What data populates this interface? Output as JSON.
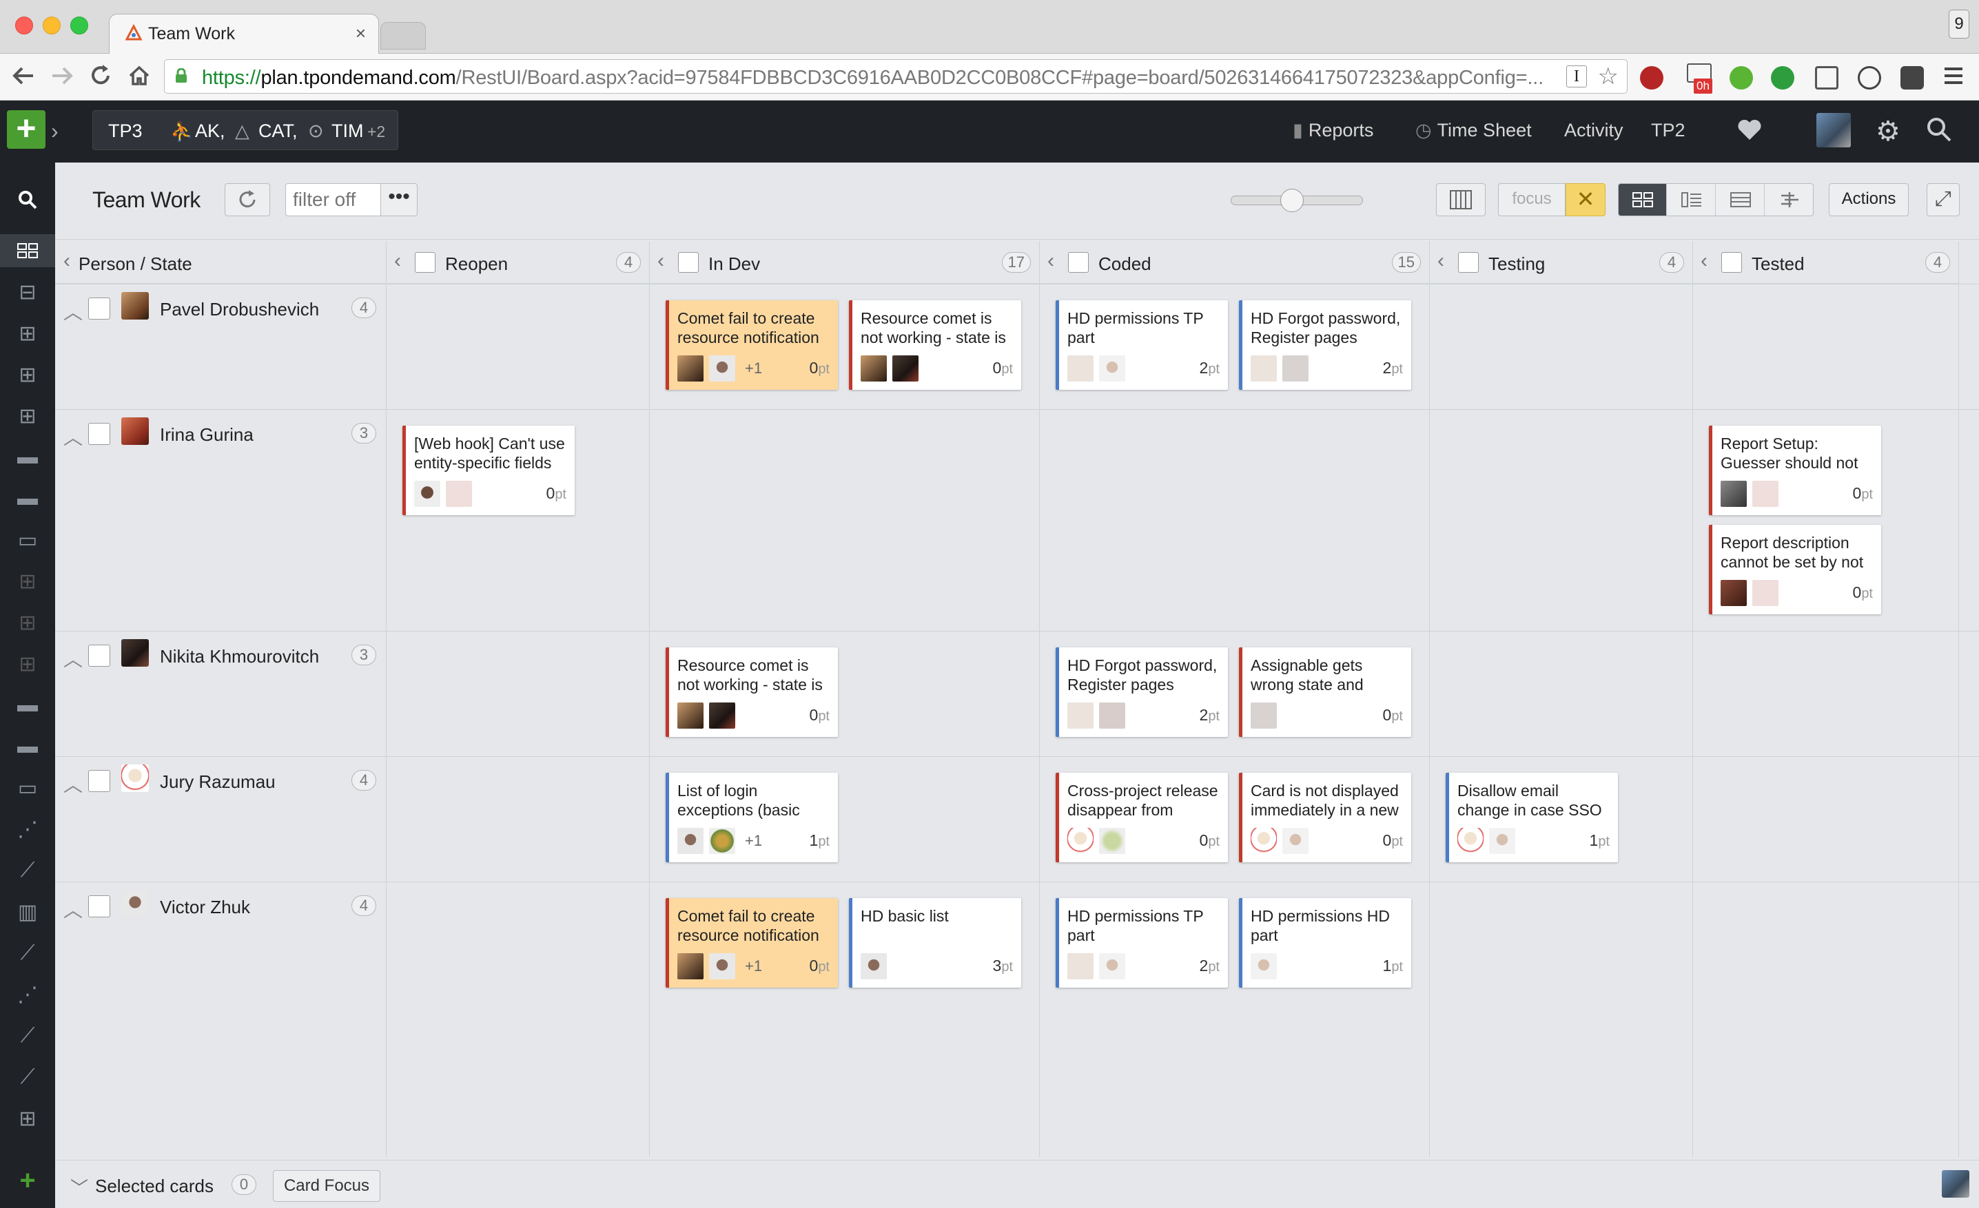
{
  "browser": {
    "tab_title": "Team Work",
    "tab_close": "×",
    "profile_badge": "9",
    "url_scheme": "https://",
    "url_domain": "plan.tpondemand.com",
    "url_rest": "/RestUI/Board.aspx?acid=97584FDBBCD3C6916AAB0D2CC0B08CCF#page=board/5026314664175072323&appConfig=...",
    "ext_badge": "0h"
  },
  "app": {
    "context": {
      "project": "TP3",
      "team1": "AK,",
      "team2": "CAT,",
      "team3": "TIM",
      "more": "+2"
    },
    "nav": {
      "reports": "Reports",
      "timesheet": "Time Sheet",
      "activity": "Activity",
      "tp2": "TP2"
    }
  },
  "board": {
    "title": "Team Work",
    "filter_placeholder": "filter off",
    "more_label": "•••",
    "focus_label": "focus",
    "actions_label": "Actions",
    "corner_label": "Person / State",
    "columns": [
      {
        "label": "Reopen",
        "count": "4"
      },
      {
        "label": "In Dev",
        "count": "17"
      },
      {
        "label": "Coded",
        "count": "15"
      },
      {
        "label": "Testing",
        "count": "4"
      },
      {
        "label": "Tested",
        "count": "4"
      }
    ],
    "rows": [
      {
        "name": "Pavel Drobushevich",
        "count": "4"
      },
      {
        "name": "Irina Gurina",
        "count": "3"
      },
      {
        "name": "Nikita Khmourovitch",
        "count": "3"
      },
      {
        "name": "Jury Razumau",
        "count": "4"
      },
      {
        "name": "Victor Zhuk",
        "count": "4"
      }
    ],
    "cards": {
      "p_indev_1": {
        "title": "Comet fail to create resource notification",
        "more": "+1",
        "pts": "0",
        "unit": "pt"
      },
      "p_indev_2": {
        "title": "Resource comet is not working - state is",
        "pts": "0",
        "unit": "pt"
      },
      "p_coded_1": {
        "title": "HD permissions TP part",
        "pts": "2",
        "unit": "pt"
      },
      "p_coded_2": {
        "title": "HD Forgot password, Register pages",
        "pts": "2",
        "unit": "pt"
      },
      "i_reopen_1": {
        "title": "[Web hook] Can't use entity-specific fields",
        "pts": "0",
        "unit": "pt"
      },
      "i_tested_1": {
        "title": "Report Setup: Guesser should not",
        "pts": "0",
        "unit": "pt"
      },
      "i_tested_2": {
        "title": "Report description cannot be set by not",
        "pts": "0",
        "unit": "pt"
      },
      "n_indev_1": {
        "title": "Resource comet is not working - state is",
        "pts": "0",
        "unit": "pt"
      },
      "n_coded_1": {
        "title": "HD Forgot password, Register pages",
        "pts": "2",
        "unit": "pt"
      },
      "n_coded_2": {
        "title": "Assignable gets wrong state and",
        "pts": "0",
        "unit": "pt"
      },
      "j_indev_1": {
        "title": "List of login exceptions (basic",
        "more": "+1",
        "pts": "1",
        "unit": "pt"
      },
      "j_coded_1": {
        "title": "Cross-project release disappear from",
        "pts": "0",
        "unit": "pt"
      },
      "j_coded_2": {
        "title": "Card is not displayed immediately in a new",
        "pts": "0",
        "unit": "pt"
      },
      "j_testing_1": {
        "title": "Disallow email change in case SSO is",
        "pts": "1",
        "unit": "pt"
      },
      "v_indev_1": {
        "title": "Comet fail to create resource notification",
        "more": "+1",
        "pts": "0",
        "unit": "pt"
      },
      "v_indev_2": {
        "title": "HD basic list",
        "pts": "3",
        "unit": "pt"
      },
      "v_coded_1": {
        "title": "HD permissions TP part",
        "pts": "2",
        "unit": "pt"
      },
      "v_coded_2": {
        "title": "HD permissions HD part",
        "pts": "1",
        "unit": "pt"
      }
    }
  },
  "footer": {
    "selected_label": "Selected cards",
    "selected_count": "0",
    "card_focus": "Card Focus"
  },
  "colors": {
    "accent_green": "#4a9d31",
    "bug_red": "#c0392b",
    "story_blue": "#4a7cc7",
    "highlight": "#fdd9a0",
    "focus_yellow": "#f5d56b"
  }
}
